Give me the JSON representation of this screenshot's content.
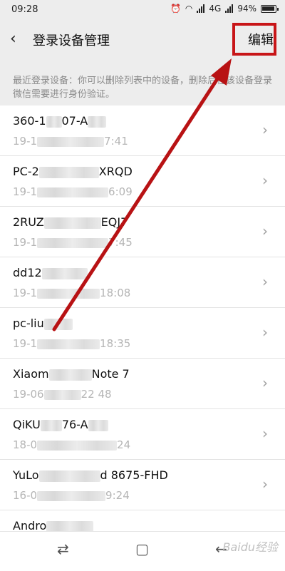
{
  "status_bar": {
    "time": "09:28",
    "network": "4G",
    "battery": "94%"
  },
  "header": {
    "title": "登录设备管理",
    "edit_label": "编辑"
  },
  "description": "最近登录设备：你可以删除列表中的设备，删除后在该设备登录微信需要进行身份验证。",
  "devices": [
    {
      "name_a": "360-1",
      "name_b": "07-A",
      "name_c": "",
      "time_a": "19-1",
      "time_b": "7:41"
    },
    {
      "name_a": "PC-2",
      "name_b": "",
      "name_c": "XRQD",
      "time_a": "19-1",
      "time_b": "6:09"
    },
    {
      "name_a": "2RUZ",
      "name_b": "",
      "name_c": "EQJ7",
      "time_a": "19-1",
      "time_b": "7:45"
    },
    {
      "name_a": "dd12",
      "name_b": "",
      "name_c": "",
      "time_a": "19-1",
      "time_b": "18:08"
    },
    {
      "name_a": "pc-liu",
      "name_b": "",
      "name_c": "",
      "time_a": "19-1",
      "time_b": "18:35"
    },
    {
      "name_a": "Xiaom",
      "name_b": "",
      "name_c": "Note 7",
      "time_a": "19-06",
      "time_b": "22   48"
    },
    {
      "name_a": "QiKU",
      "name_b": "76-A",
      "name_c": "",
      "time_a": "18-0",
      "time_b": "24"
    },
    {
      "name_a": "YuLo",
      "name_b": "",
      "name_c": "d 8675-FHD",
      "time_a": "16-0",
      "time_b": "9:24"
    },
    {
      "name_a": "Andro",
      "name_b": "",
      "name_c": "",
      "time_a": "",
      "time_b": ""
    }
  ],
  "icons": {
    "back": "back-arrow-icon",
    "chevron": "chevron-right-icon"
  },
  "navigation": {
    "watermark": "Baidu经验"
  },
  "colors": {
    "annotation_red": "#c81518",
    "background": "#ededed"
  }
}
